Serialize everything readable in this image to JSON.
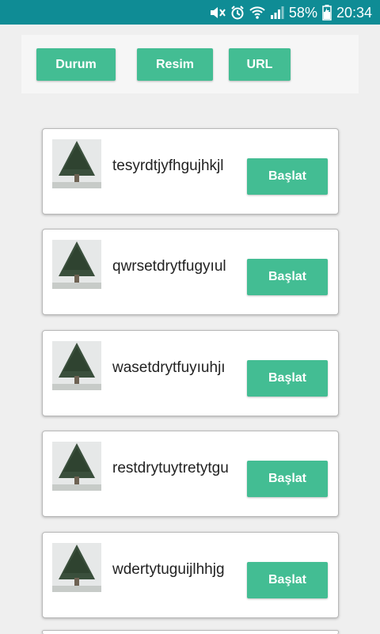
{
  "status_bar": {
    "battery": "58%",
    "time": "20:34",
    "icons": [
      "mute-icon",
      "alarm-icon",
      "wifi-icon",
      "signal-icon",
      "battery-icon"
    ]
  },
  "toolbar": {
    "durum_label": "Durum",
    "resim_label": "Resim",
    "url_label": "URL"
  },
  "items": [
    {
      "title": "tesyrdtjyfhgujhkjl",
      "button": "Başlat",
      "icon": "tree-thumbnail-icon"
    },
    {
      "title": "qwrsetdrytfugyıul",
      "button": "Başlat",
      "icon": "tree-thumbnail-icon"
    },
    {
      "title": "wasetdrytfuyıuhjı",
      "button": "Başlat",
      "icon": "tree-thumbnail-icon"
    },
    {
      "title": "restdrytuytretytgu",
      "button": "Başlat",
      "icon": "tree-thumbnail-icon"
    },
    {
      "title": "wdertytuguijlhhjg",
      "button": "Başlat",
      "icon": "tree-thumbnail-icon"
    }
  ],
  "colors": {
    "status_bar": "#0f8c95",
    "accent_button": "#43bd93",
    "background": "#efefef"
  }
}
